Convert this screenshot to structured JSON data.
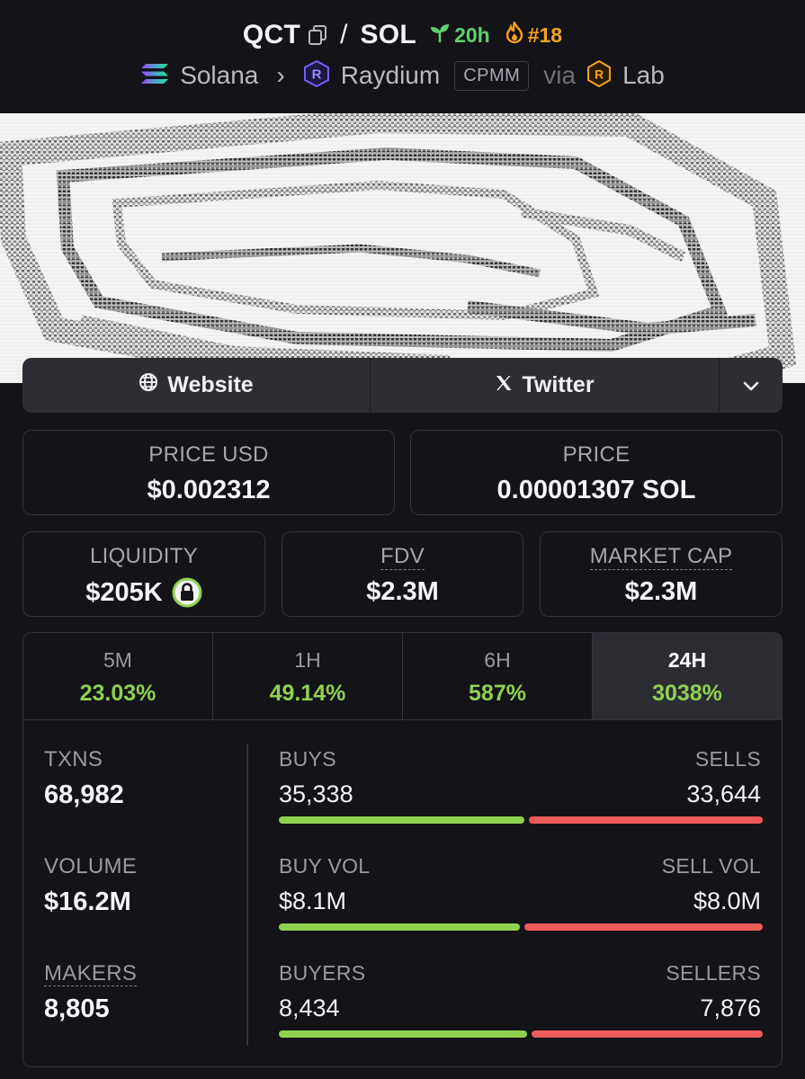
{
  "header": {
    "base_symbol": "QCT",
    "separator": "/",
    "quote_symbol": "SOL",
    "age": "20h",
    "rank": "#18",
    "chain": "Solana",
    "dex": "Raydium",
    "pool_type": "CPMM",
    "via": "via",
    "launchpad": "Lab",
    "colors": {
      "age": "#5ed170",
      "rank": "#f6a21d",
      "dex_icon": "#7a5cff",
      "launchpad_icon": "#f6a21d"
    }
  },
  "links": {
    "website": "Website",
    "twitter": "Twitter",
    "icons": {
      "website": "globe-icon",
      "twitter": "x-logo-icon",
      "more": "chevron-down-icon"
    }
  },
  "prices": {
    "usd_label": "PRICE USD",
    "usd_value": "$0.002312",
    "native_label": "PRICE",
    "native_value": "0.00001307 SOL"
  },
  "metrics": {
    "liquidity_label": "LIQUIDITY",
    "liquidity_value": "$205K",
    "fdv_label": "FDV",
    "fdv_value": "$2.3M",
    "mcap_label": "MARKET CAP",
    "mcap_value": "$2.3M",
    "liquidity_locked_icon": "lock-icon"
  },
  "timeframes": [
    {
      "label": "5M",
      "change": "23.03%",
      "active": false
    },
    {
      "label": "1H",
      "change": "49.14%",
      "active": false
    },
    {
      "label": "6H",
      "change": "587%",
      "active": false
    },
    {
      "label": "24H",
      "change": "3038%",
      "active": true
    }
  ],
  "stats": {
    "txns_label": "TXNS",
    "txns_value": "68,982",
    "volume_label": "VOLUME",
    "volume_value": "$16.2M",
    "makers_label": "MAKERS",
    "makers_value": "8,805",
    "buys_label": "BUYS",
    "buys_value": "35,338",
    "sells_label": "SELLS",
    "sells_value": "33,644",
    "buy_vol_label": "BUY VOL",
    "buy_vol_value": "$8.1M",
    "sell_vol_label": "SELL VOL",
    "sell_vol_value": "$8.0M",
    "buyers_label": "BUYERS",
    "buyers_value": "8,434",
    "sellers_label": "SELLERS",
    "sellers_value": "7,876",
    "buys_fraction": 0.512,
    "buy_vol_fraction": 0.503,
    "buyers_fraction": 0.517,
    "colors": {
      "buy": "#8fd14f",
      "sell": "#ef5a5a"
    }
  }
}
